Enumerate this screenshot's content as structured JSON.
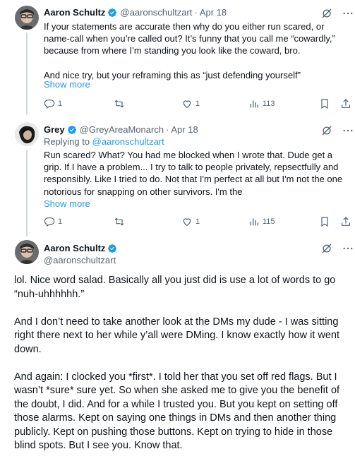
{
  "tweets": [
    {
      "name": "Aaron Schultz",
      "handle": "@aaronschultzart",
      "time": "Apr 18",
      "text": "If your statements are accurate then why do you either run scared, or name-call when you’re called out? It’s funny that you call me “cowardly,” because from where I’m standing you look like the coward, bro.",
      "text2": "And nice try, but your reframing this as “just defending yourself”",
      "show_more": "Show more",
      "replies": "1",
      "retweets": "",
      "likes": "1",
      "views": "113"
    },
    {
      "name": "Grey",
      "handle": "@GreyAreaMonarch",
      "time": "Apr 18",
      "replying_prefix": "Replying to",
      "replying_handle": "@aaronschultzart",
      "text": "Run scared? What? You had me blocked when I wrote that. Dude get a grip. If I have a problem... I try to talk to people privately, repsectfully and responsibly. Like I tried to do. Not that I'm perfect at all but I'm not the one notorious for snapping on other survivors. I'm the",
      "show_more": "Show more",
      "replies": "1",
      "retweets": "",
      "likes": "1",
      "views": "115"
    }
  ],
  "main_tweet": {
    "name": "Aaron Schultz",
    "handle": "@aaronschultzart",
    "paragraphs": [
      "lol. Nice word salad. Basically all you just did is use a lot of words to go “nuh-uhhhhhh.”",
      "And I don’t need to take another look at the DMs my dude - I was sitting right there next to her while y’all were DMing. I know exactly how it went down.",
      "And again: I clocked you *first*. I told her that you set off red flags. But I wasn’t *sure* sure yet. So when she asked me to give you the benefit of the doubt, I did. And for a while I trusted you. But you kept on setting off those alarms. Kept on saying one things in DMs and then another thing publicly. Kept on pushing those buttons. Kept on trying to hide in those blind spots. But I see you. Know that."
    ]
  },
  "colors": {
    "link": "#1d9bf0",
    "secondary": "#536471",
    "thread_line": "#cfd9de",
    "verified": "#1d9bf0"
  }
}
